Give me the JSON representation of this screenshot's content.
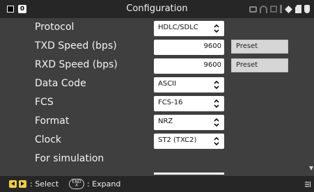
{
  "titlebar": {
    "badge": "0",
    "title": "Configuration",
    "status_icons": [
      "printer-icon",
      "wifi-icon",
      "lan-icon",
      "usb-icon",
      "pen-icon",
      "sd-card-icon",
      "power-plug-icon"
    ]
  },
  "rows": [
    {
      "label": "Protocol",
      "control": "select",
      "value": "HDLC/SDLC"
    },
    {
      "label": "TXD Speed (bps)",
      "control": "input",
      "value": "9600",
      "button": "Preset"
    },
    {
      "label": "RXD Speed (bps)",
      "control": "input",
      "value": "9600",
      "button": "Preset"
    },
    {
      "label": "Data Code",
      "control": "select",
      "value": "ASCII"
    },
    {
      "label": "FCS",
      "control": "select",
      "value": "FCS-16"
    },
    {
      "label": "Format",
      "control": "select",
      "value": "NRZ"
    },
    {
      "label": "Clock",
      "control": "select",
      "value": "ST2 (TXC2)"
    },
    {
      "label": "For simulation"
    }
  ],
  "footer": {
    "select_text": ": Select",
    "end_key": "END",
    "end_key_sub": "X",
    "expand_text": ": Expand"
  },
  "colors": {
    "background": "#3f3f3f",
    "bar": "#262626",
    "arrow_key": "#f2ce3d",
    "preset_button": "#d6d6d6"
  }
}
